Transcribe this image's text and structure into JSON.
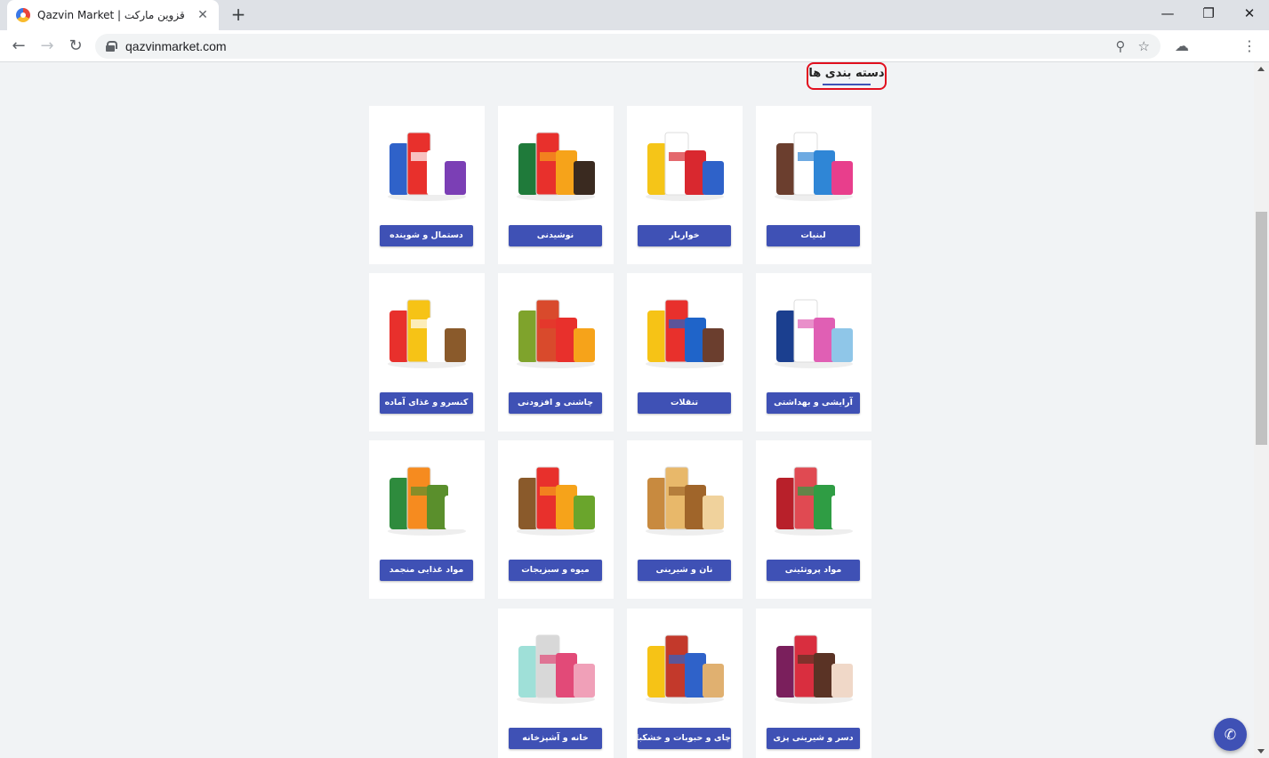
{
  "browser": {
    "tab_title": "قزوین مارکت | Qazvin Market",
    "tab_close": "✕",
    "new_tab": "+",
    "url": "qazvinmarket.com",
    "window_controls": {
      "minimize": "—",
      "restore": "❐",
      "close": "✕"
    },
    "nav": {
      "back": "←",
      "forward": "→",
      "reload": "↻"
    },
    "omnibox_icons": {
      "zoom": "⚲",
      "star": "☆"
    },
    "toolbar_icons": {
      "extension": "☁",
      "menu": "⋮"
    }
  },
  "page": {
    "heading": "دسته بندی ها",
    "call_icon": "✆",
    "categories": [
      {
        "label": "لبنیات",
        "icon": "dairy-products-image"
      },
      {
        "label": "خواربار",
        "icon": "groceries-image"
      },
      {
        "label": "نوشیدنی",
        "icon": "beverages-image"
      },
      {
        "label": "دستمال و شوینده",
        "icon": "tissue-detergent-image"
      },
      {
        "label": "آرایشی و بهداشتی",
        "icon": "cosmetics-hygiene-image"
      },
      {
        "label": "تنقلات",
        "icon": "snacks-image"
      },
      {
        "label": "چاشنی و افزودنی",
        "icon": "condiments-image"
      },
      {
        "label": "کنسرو و غذای آماده",
        "icon": "canned-ready-food-image"
      },
      {
        "label": "مواد پروتئینی",
        "icon": "protein-products-image"
      },
      {
        "label": "نان و شیرینی",
        "icon": "bread-pastry-image"
      },
      {
        "label": "میوه و سبزیجات",
        "icon": "fruit-vegetables-image"
      },
      {
        "label": "مواد غذایی منجمد",
        "icon": "frozen-food-image"
      },
      {
        "label": "دسر و شیرینی پزی",
        "icon": "dessert-baking-image"
      },
      {
        "label": "چای و حبوبات و خشکبار",
        "icon": "tea-legumes-nuts-image"
      },
      {
        "label": "خانه و آشپزخانه",
        "icon": "home-kitchen-image"
      }
    ]
  }
}
